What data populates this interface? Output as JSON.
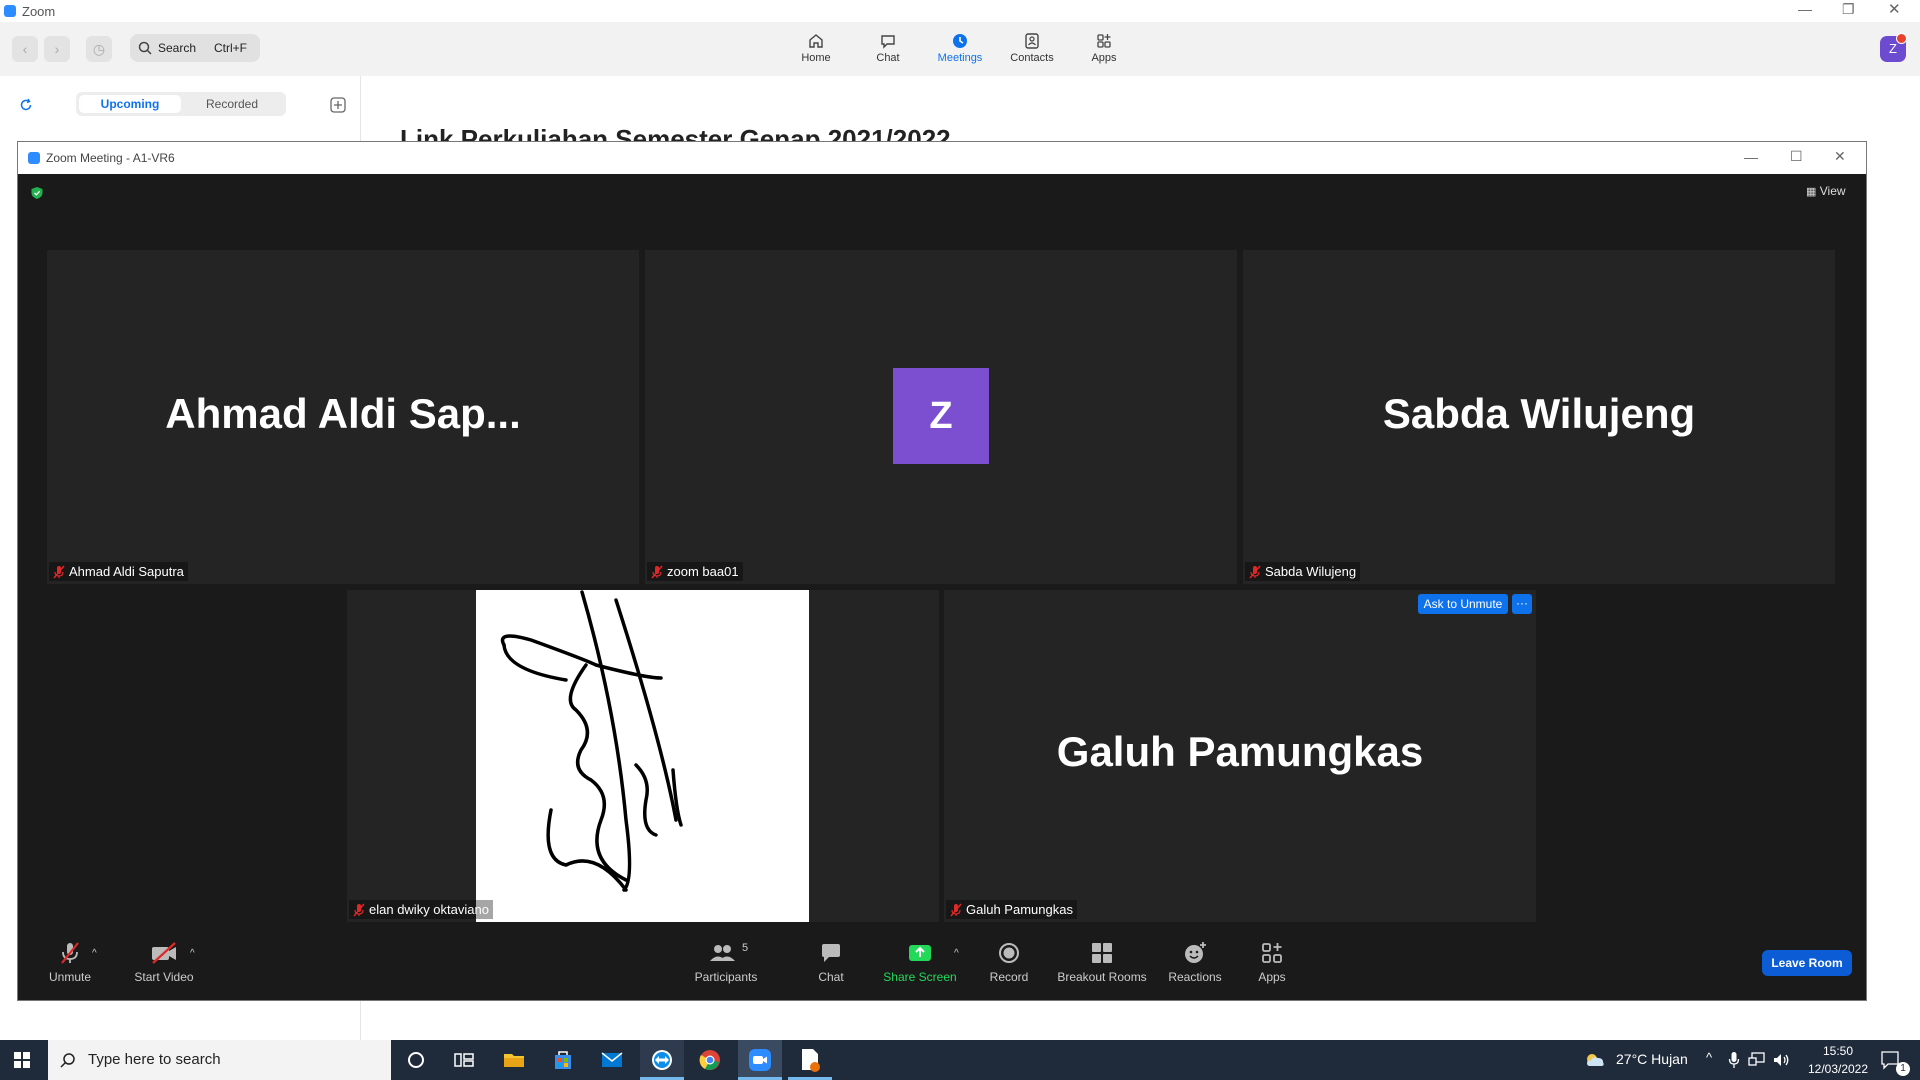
{
  "app": {
    "title": "Zoom"
  },
  "toolbar": {
    "search_label": "Search",
    "search_shortcut": "Ctrl+F",
    "nav": [
      {
        "label": "Home",
        "icon": "home-icon"
      },
      {
        "label": "Chat",
        "icon": "chat-icon"
      },
      {
        "label": "Meetings",
        "icon": "clock-icon",
        "active": true
      },
      {
        "label": "Contacts",
        "icon": "contacts-icon"
      },
      {
        "label": "Apps",
        "icon": "apps-icon"
      }
    ],
    "avatar_letter": "Z"
  },
  "sidebar": {
    "tabs": [
      "Upcoming",
      "Recorded"
    ],
    "active_tab": "Upcoming"
  },
  "main": {
    "heading": "Link Perkuliahan Semester Genap 2021/2022"
  },
  "meeting": {
    "window_title": "Zoom Meeting - A1-VR6",
    "view_label": "View",
    "tiles": [
      {
        "display": "Ahmad  Aldi  Sap...",
        "label": "Ahmad Aldi Saputra"
      },
      {
        "avatar": "Z",
        "label": "zoom baa01"
      },
      {
        "display": "Sabda Wilujeng",
        "label": "Sabda Wilujeng"
      },
      {
        "label": "elan dwiky oktaviano"
      },
      {
        "display": "Galuh Pamungkas",
        "label": "Galuh Pamungkas"
      }
    ],
    "ask_unmute": "Ask to Unmute",
    "more": "···",
    "controls": {
      "unmute": "Unmute",
      "start_video": "Start Video",
      "participants": "Participants",
      "participants_count": "5",
      "chat": "Chat",
      "share_screen": "Share Screen",
      "record": "Record",
      "breakout": "Breakout Rooms",
      "reactions": "Reactions",
      "apps": "Apps",
      "leave": "Leave Room"
    },
    "colors": {
      "share": "#23d959",
      "accent": "#0e72ed",
      "avatar": "#7b4fcf",
      "mute": "#e02828"
    }
  },
  "taskbar": {
    "search_placeholder": "Type here to search",
    "weather": "27°C  Hujan",
    "time": "15:50",
    "date": "12/03/2022",
    "notif_count": "1"
  }
}
